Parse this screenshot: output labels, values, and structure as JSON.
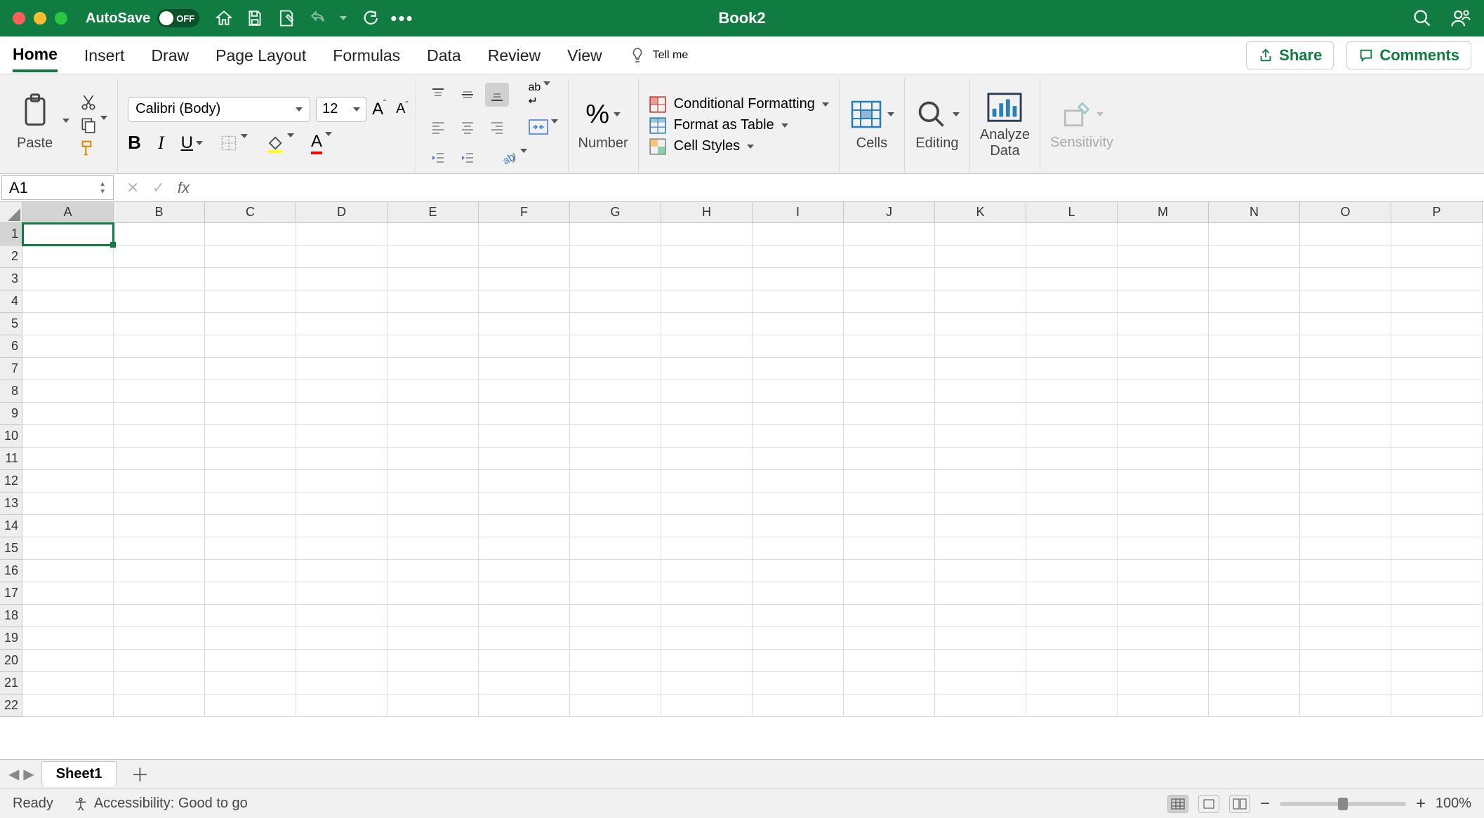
{
  "titlebar": {
    "autosave_label": "AutoSave",
    "autosave_state": "OFF",
    "document_title": "Book2"
  },
  "tabs": [
    "Home",
    "Insert",
    "Draw",
    "Page Layout",
    "Formulas",
    "Data",
    "Review",
    "View"
  ],
  "active_tab": "Home",
  "tellme_label": "Tell me",
  "share_label": "Share",
  "comments_label": "Comments",
  "ribbon": {
    "paste_label": "Paste",
    "font_name": "Calibri (Body)",
    "font_size": "12",
    "number_label": "Number",
    "cond_fmt_label": "Conditional Formatting",
    "fmt_table_label": "Format as Table",
    "cell_styles_label": "Cell Styles",
    "cells_label": "Cells",
    "editing_label": "Editing",
    "analyze_label_1": "Analyze",
    "analyze_label_2": "Data",
    "sensitivity_label": "Sensitivity"
  },
  "name_box": "A1",
  "columns": [
    "A",
    "B",
    "C",
    "D",
    "E",
    "F",
    "G",
    "H",
    "I",
    "J",
    "K",
    "L",
    "M",
    "N",
    "O",
    "P"
  ],
  "row_count": 22,
  "selected_cell": "A1",
  "sheet_tab": "Sheet1",
  "status": {
    "ready": "Ready",
    "accessibility": "Accessibility: Good to go",
    "zoom": "100%"
  }
}
